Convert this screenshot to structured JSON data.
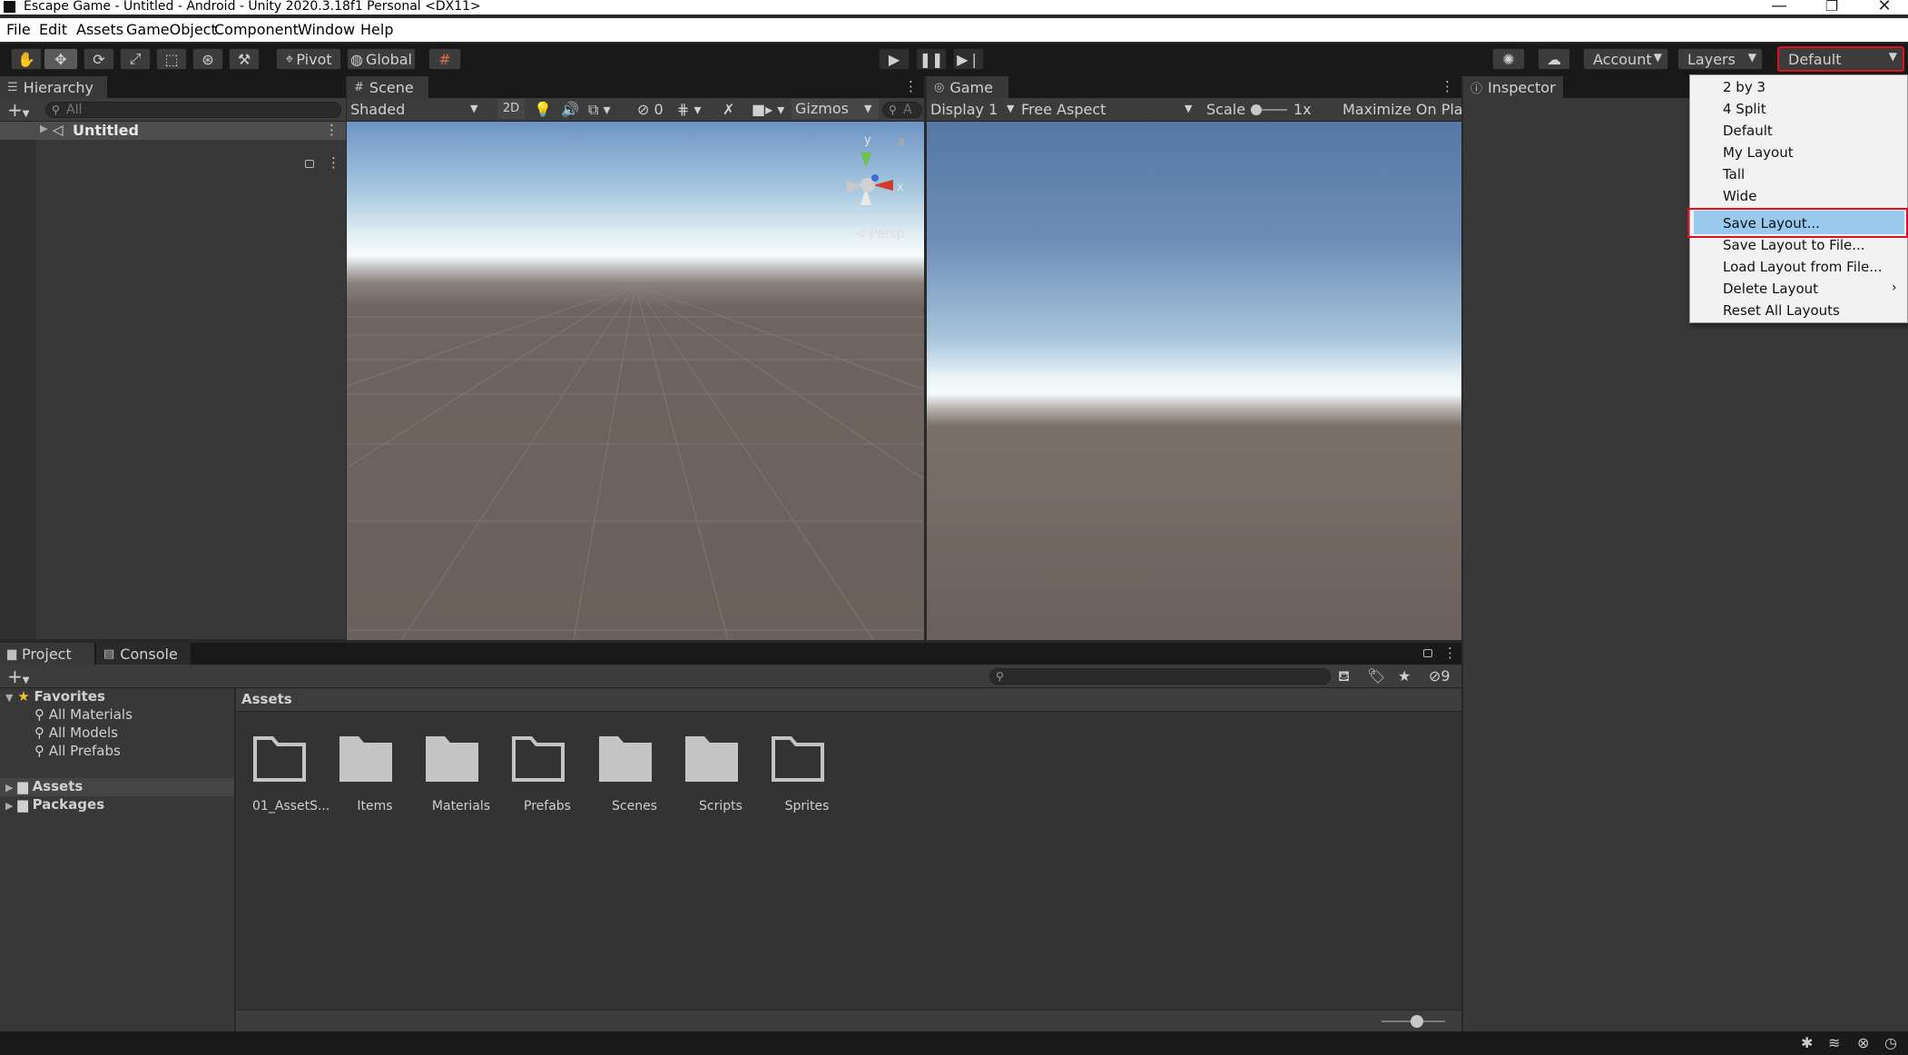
{
  "window": {
    "title": "Escape Game - Untitled - Android - Unity 2020.3.18f1 Personal <DX11>"
  },
  "menu": {
    "items": [
      "File",
      "Edit",
      "Assets",
      "GameObject",
      "Component",
      "Window",
      "Help"
    ]
  },
  "toolbar": {
    "pivot": "Pivot",
    "global": "Global",
    "account": "Account",
    "layers": "Layers",
    "layout": "Default"
  },
  "hierarchy": {
    "tab": "Hierarchy",
    "search_placeholder": "All",
    "root": "Untitled"
  },
  "scene": {
    "tab": "Scene",
    "shading": "Shaded",
    "mode_2d": "2D",
    "hidden_count": "0",
    "gizmos": "Gizmos",
    "search_placeholder": "A",
    "persp": "< Persp",
    "axis_y": "y",
    "axis_x": "x"
  },
  "game": {
    "tab": "Game",
    "display": "Display 1",
    "aspect": "Free Aspect",
    "scale_label": "Scale",
    "scale_value": "1x",
    "maximize": "Maximize On Play"
  },
  "inspector": {
    "tab": "Inspector"
  },
  "project": {
    "tab_project": "Project",
    "tab_console": "Console",
    "hidden_count": "9",
    "favorites": "Favorites",
    "favorites_items": [
      "All Materials",
      "All Models",
      "All Prefabs"
    ],
    "assets": "Assets",
    "packages": "Packages",
    "breadcrumb": "Assets",
    "folders": [
      "01_AssetS...",
      "Items",
      "Materials",
      "Prefabs",
      "Scenes",
      "Scripts",
      "Sprites"
    ]
  },
  "layout_menu": {
    "items": [
      "2 by 3",
      "4 Split",
      "Default",
      "My Layout",
      "Tall",
      "Wide"
    ],
    "actions": [
      "Save Layout...",
      "Save Layout to File...",
      "Load Layout from File...",
      "Delete Layout",
      "Reset All Layouts"
    ],
    "highlighted": "Save Layout..."
  },
  "colors": {
    "accent_highlight": "#99c9ef",
    "annotation_red": "#e0101e",
    "editor_bg": "#383838",
    "toolbar_bg": "#191919"
  }
}
